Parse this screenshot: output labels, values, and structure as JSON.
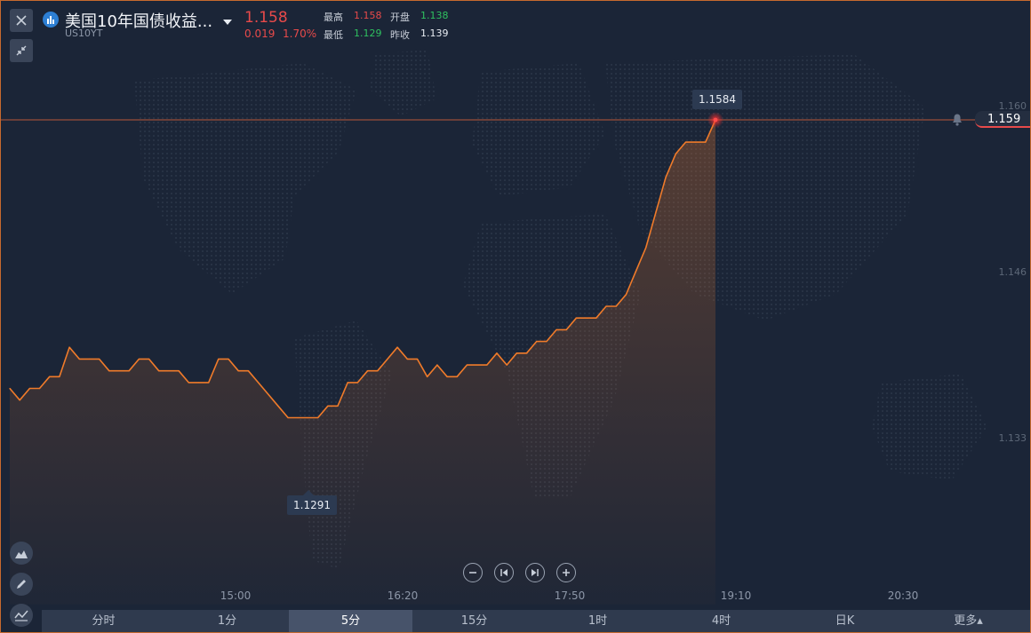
{
  "header": {
    "title": "美国10年国债收益...",
    "symbol": "US10YT",
    "price": "1.158",
    "change": "0.019",
    "change_pct": "1.70%"
  },
  "stats": {
    "high_label": "最高",
    "high": "1.158",
    "open_label": "开盘",
    "open": "1.138",
    "low_label": "最低",
    "low": "1.129",
    "prev_close_label": "昨收",
    "prev_close": "1.139"
  },
  "y_ticks": [
    "1.160",
    "1.146",
    "1.133"
  ],
  "x_ticks": [
    "15:00",
    "16:20",
    "17:50",
    "19:10",
    "20:30"
  ],
  "max_label": "1.1584",
  "min_label": "1.1291",
  "current_price_tag": "1.159",
  "tabs": [
    {
      "label": "分时",
      "active": false
    },
    {
      "label": "1分",
      "active": false
    },
    {
      "label": "5分",
      "active": true
    },
    {
      "label": "15分",
      "active": false
    },
    {
      "label": "1时",
      "active": false
    },
    {
      "label": "4时",
      "active": false
    },
    {
      "label": "日K",
      "active": false
    },
    {
      "label": "更多▴",
      "active": false
    }
  ],
  "colors": {
    "line": "#f07b2a",
    "up": "#e84a4a",
    "down": "#2fc160",
    "background": "#1b2537"
  },
  "icons": {
    "close": "close-icon",
    "collapse": "collapse-icon",
    "logo": "bar-chart-icon",
    "dropdown": "caret-down-icon",
    "alert": "bell-icon",
    "chart_type": "mountain-chart-icon",
    "draw": "pencil-icon",
    "indicator": "indicator-icon",
    "zoom_out": "minus-icon",
    "go_start": "skip-back-icon",
    "go_end": "skip-forward-icon",
    "zoom_in": "plus-icon"
  },
  "chart_data": {
    "type": "area",
    "y_range": [
      1.125,
      1.162
    ],
    "x_tick_labels": [
      "15:00",
      "16:20",
      "17:50",
      "19:10",
      "20:30"
    ],
    "values": [
      1.1355,
      1.1345,
      1.1355,
      1.1355,
      1.1365,
      1.1365,
      1.139,
      1.138,
      1.138,
      1.138,
      1.137,
      1.137,
      1.137,
      1.138,
      1.138,
      1.137,
      1.137,
      1.137,
      1.136,
      1.136,
      1.136,
      1.138,
      1.138,
      1.137,
      1.137,
      1.136,
      1.135,
      1.134,
      1.133,
      1.133,
      1.133,
      1.133,
      1.134,
      1.134,
      1.136,
      1.136,
      1.137,
      1.137,
      1.138,
      1.139,
      1.138,
      1.138,
      1.1365,
      1.1375,
      1.1365,
      1.1365,
      1.1375,
      1.1375,
      1.1375,
      1.1385,
      1.1375,
      1.1385,
      1.1385,
      1.1395,
      1.1395,
      1.1405,
      1.1405,
      1.1415,
      1.1415,
      1.1415,
      1.1425,
      1.1425,
      1.1435,
      1.1455,
      1.1475,
      1.1505,
      1.1535,
      1.1555,
      1.1565,
      1.1565,
      1.1565,
      1.1584
    ],
    "max_value": 1.1584,
    "min_value": 1.1291,
    "current_value": 1.159
  }
}
